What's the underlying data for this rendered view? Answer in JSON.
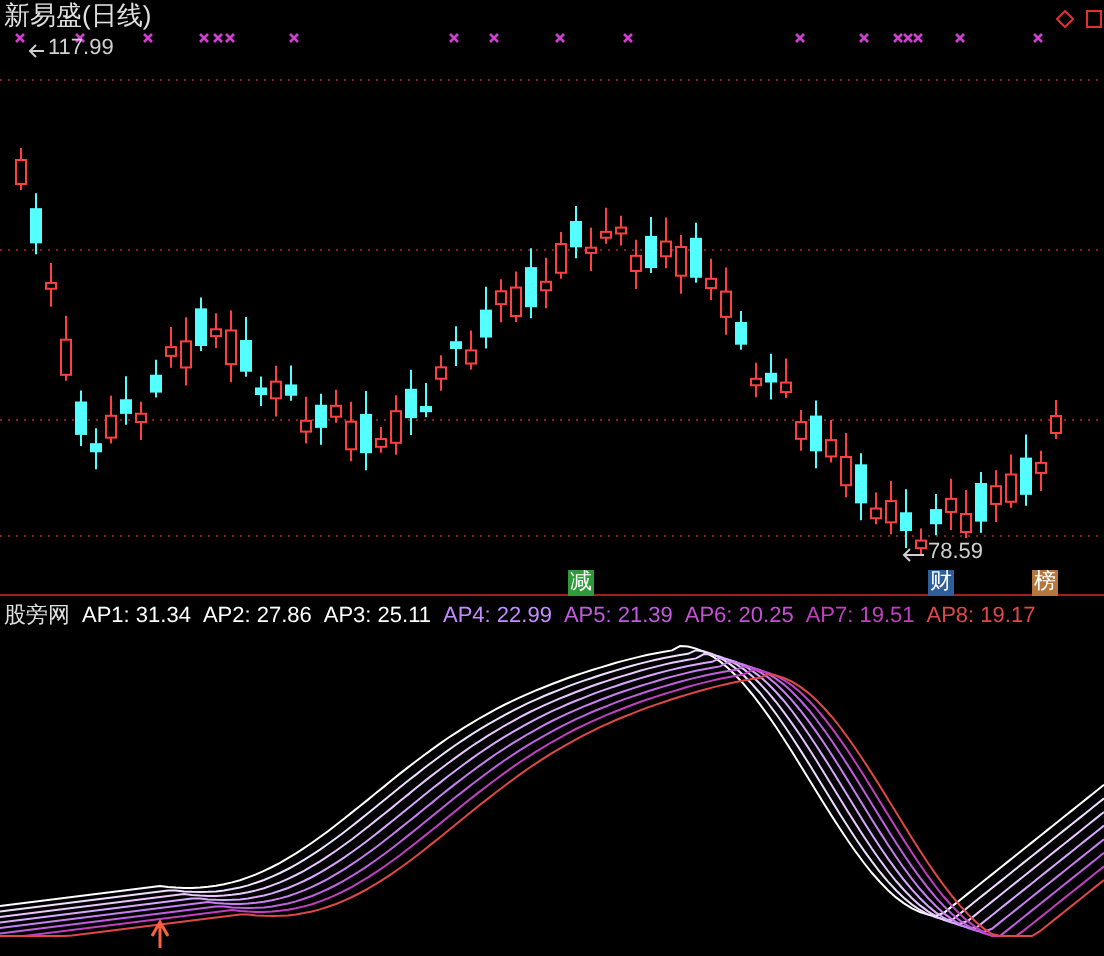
{
  "chart": {
    "title": "新易盛(日线)",
    "high_label": "117.99",
    "low_label": "78.59",
    "badges": [
      {
        "text": "减",
        "color": "#2f9a3a"
      },
      {
        "text": "财",
        "color": "#2f5f9a"
      },
      {
        "text": "榜",
        "color": "#b8773a"
      }
    ]
  },
  "indicator": {
    "name": "股旁网",
    "values": [
      {
        "text": "AP1: 31.34",
        "color": "#ffffff"
      },
      {
        "text": "AP2: 27.86",
        "color": "#ffffff"
      },
      {
        "text": "AP3: 25.11",
        "color": "#ffffff"
      },
      {
        "text": "AP4: 22.99",
        "color": "#c58cff"
      },
      {
        "text": "AP5: 21.39",
        "color": "#c05ce0"
      },
      {
        "text": "AP6: 20.25",
        "color": "#c850d8"
      },
      {
        "text": "AP7: 19.51",
        "color": "#c040c0"
      },
      {
        "text": "AP8: 19.17",
        "color": "#e04848"
      }
    ]
  }
}
